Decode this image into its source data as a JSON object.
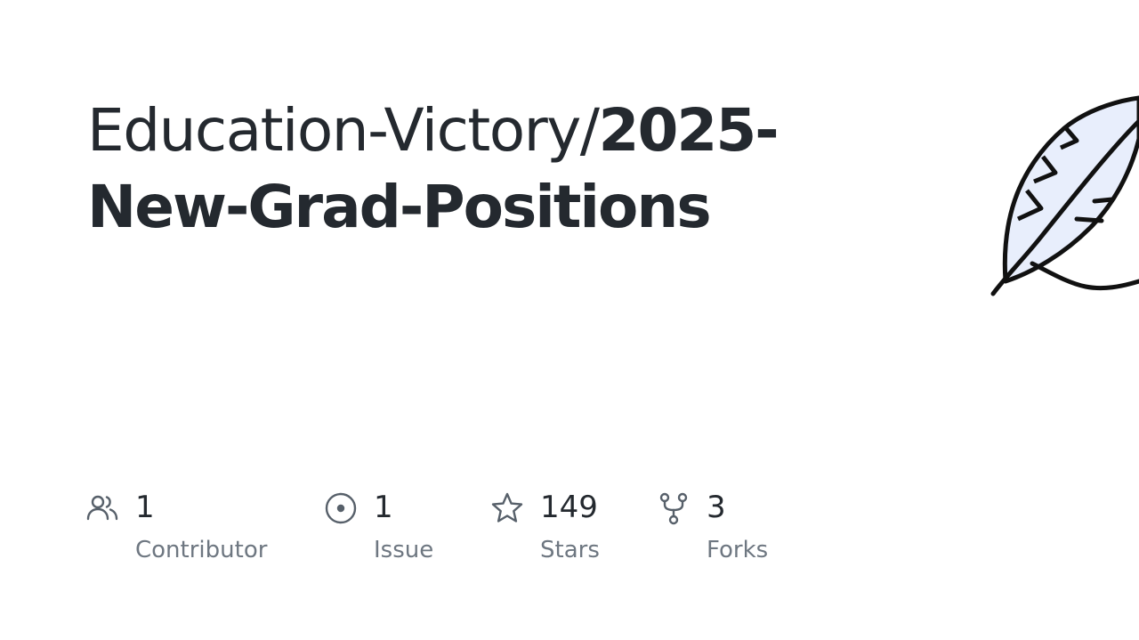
{
  "repo": {
    "owner": "Education-Victory/",
    "name": "2025-New-Grad-Positions"
  },
  "stats": {
    "contributors": {
      "count": "1",
      "label": "Contributor",
      "icon": "people-icon"
    },
    "issues": {
      "count": "1",
      "label": "Issue",
      "icon": "issue-circle-icon"
    },
    "stars": {
      "count": "149",
      "label": "Stars",
      "icon": "star-icon"
    },
    "forks": {
      "count": "3",
      "label": "Forks",
      "icon": "fork-icon"
    }
  },
  "colors": {
    "title": "#24292f",
    "label": "#6e7781",
    "icon": "#57606a",
    "feather_fill": "#e8eefc",
    "feather_stroke": "#111111"
  },
  "illustration": "feather-icon"
}
